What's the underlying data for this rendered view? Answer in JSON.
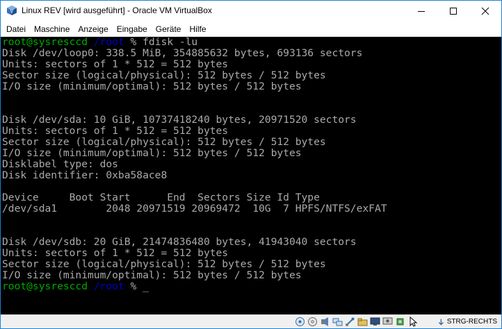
{
  "window": {
    "title": "Linux REV [wird ausgeführt] - Oracle VM VirtualBox"
  },
  "menu": [
    "Datei",
    "Maschine",
    "Anzeige",
    "Eingabe",
    "Geräte",
    "Hilfe"
  ],
  "terminal": {
    "prompt": {
      "user": "root@sysresccd",
      "path": "/root",
      "sign": "%"
    },
    "command": "fdisk -lu",
    "lines": [
      "Disk /dev/loop0: 338.5 MiB, 354885632 bytes, 693136 sectors",
      "Units: sectors of 1 * 512 = 512 bytes",
      "Sector size (logical/physical): 512 bytes / 512 bytes",
      "I/O size (minimum/optimal): 512 bytes / 512 bytes",
      "",
      "",
      "Disk /dev/sda: 10 GiB, 10737418240 bytes, 20971520 sectors",
      "Units: sectors of 1 * 512 = 512 bytes",
      "Sector size (logical/physical): 512 bytes / 512 bytes",
      "I/O size (minimum/optimal): 512 bytes / 512 bytes",
      "Disklabel type: dos",
      "Disk identifier: 0xba58ace8",
      "",
      "Device     Boot Start      End  Sectors Size Id Type",
      "/dev/sda1        2048 20971519 20969472  10G  7 HPFS/NTFS/exFAT",
      "",
      "",
      "Disk /dev/sdb: 20 GiB, 21474836480 bytes, 41943040 sectors",
      "Units: sectors of 1 * 512 = 512 bytes",
      "Sector size (logical/physical): 512 bytes / 512 bytes",
      "I/O size (minimum/optimal): 512 bytes / 512 bytes"
    ],
    "cursor": "_"
  },
  "statusbar": {
    "icons": [
      "hard-disk-icon",
      "optical-drive-icon",
      "audio-icon",
      "network-icon",
      "usb-icon",
      "shared-folders-icon",
      "display-icon",
      "video-capture-icon",
      "cpu-activity-icon",
      "mouse-integration-icon"
    ],
    "host_key": "STRG-RECHTS"
  },
  "colors": {
    "prompt_user": "#00aa00",
    "prompt_path": "#0000cc",
    "terminal_text": "#aaaaaa",
    "terminal_bg": "#000000",
    "window_border": "#1883d7"
  }
}
